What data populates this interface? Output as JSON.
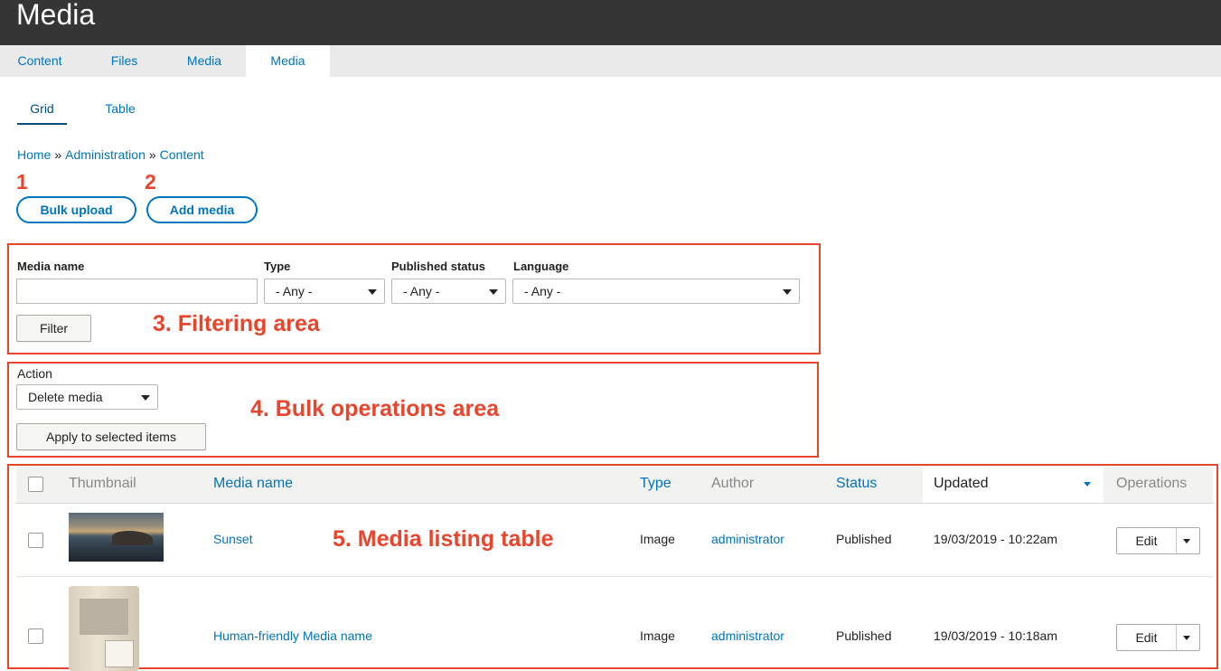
{
  "header": {
    "title": "Media"
  },
  "primary_tabs": [
    {
      "label": "Content",
      "active": false
    },
    {
      "label": "Files",
      "active": false
    },
    {
      "label": "Media",
      "active": false
    },
    {
      "label": "Media",
      "active": true
    }
  ],
  "secondary_tabs": [
    {
      "label": "Grid",
      "active": true
    },
    {
      "label": "Table",
      "active": false
    }
  ],
  "breadcrumb": [
    "Home",
    "Administration",
    "Content"
  ],
  "breadcrumb_separator": "»",
  "actions": {
    "bulk_upload": {
      "number": "1",
      "label": "Bulk upload"
    },
    "add_media": {
      "number": "2",
      "label": "Add media"
    }
  },
  "filters": {
    "media_name_label": "Media name",
    "media_name_value": "",
    "type_label": "Type",
    "type_value": "- Any -",
    "published_label": "Published status",
    "published_value": "- Any -",
    "language_label": "Language",
    "language_value": "- Any -",
    "filter_button": "Filter",
    "annotation": "3. Filtering area"
  },
  "bulk": {
    "action_label": "Action",
    "action_value": "Delete media",
    "apply_button": "Apply to selected items",
    "annotation": "4. Bulk operations area"
  },
  "table": {
    "annotation": "5. Media listing table",
    "columns": {
      "thumbnail": "Thumbnail",
      "name": "Media name",
      "type": "Type",
      "author": "Author",
      "status": "Status",
      "updated": "Updated",
      "operations": "Operations"
    },
    "rows": [
      {
        "name": "Sunset",
        "type": "Image",
        "author": "administrator",
        "status": "Published",
        "updated": "19/03/2019 - 10:22am",
        "op": "Edit",
        "thumbnail": "sunset-landscape-image"
      },
      {
        "name": "Human-friendly Media name",
        "type": "Image",
        "author": "administrator",
        "status": "Published",
        "updated": "19/03/2019 - 10:18am",
        "op": "Edit",
        "thumbnail": "document-package-image"
      }
    ]
  },
  "colors": {
    "link": "#0074bd",
    "annotation": "#e8452c",
    "header_bg": "#353535",
    "tabs_bg": "#eaeaea"
  }
}
